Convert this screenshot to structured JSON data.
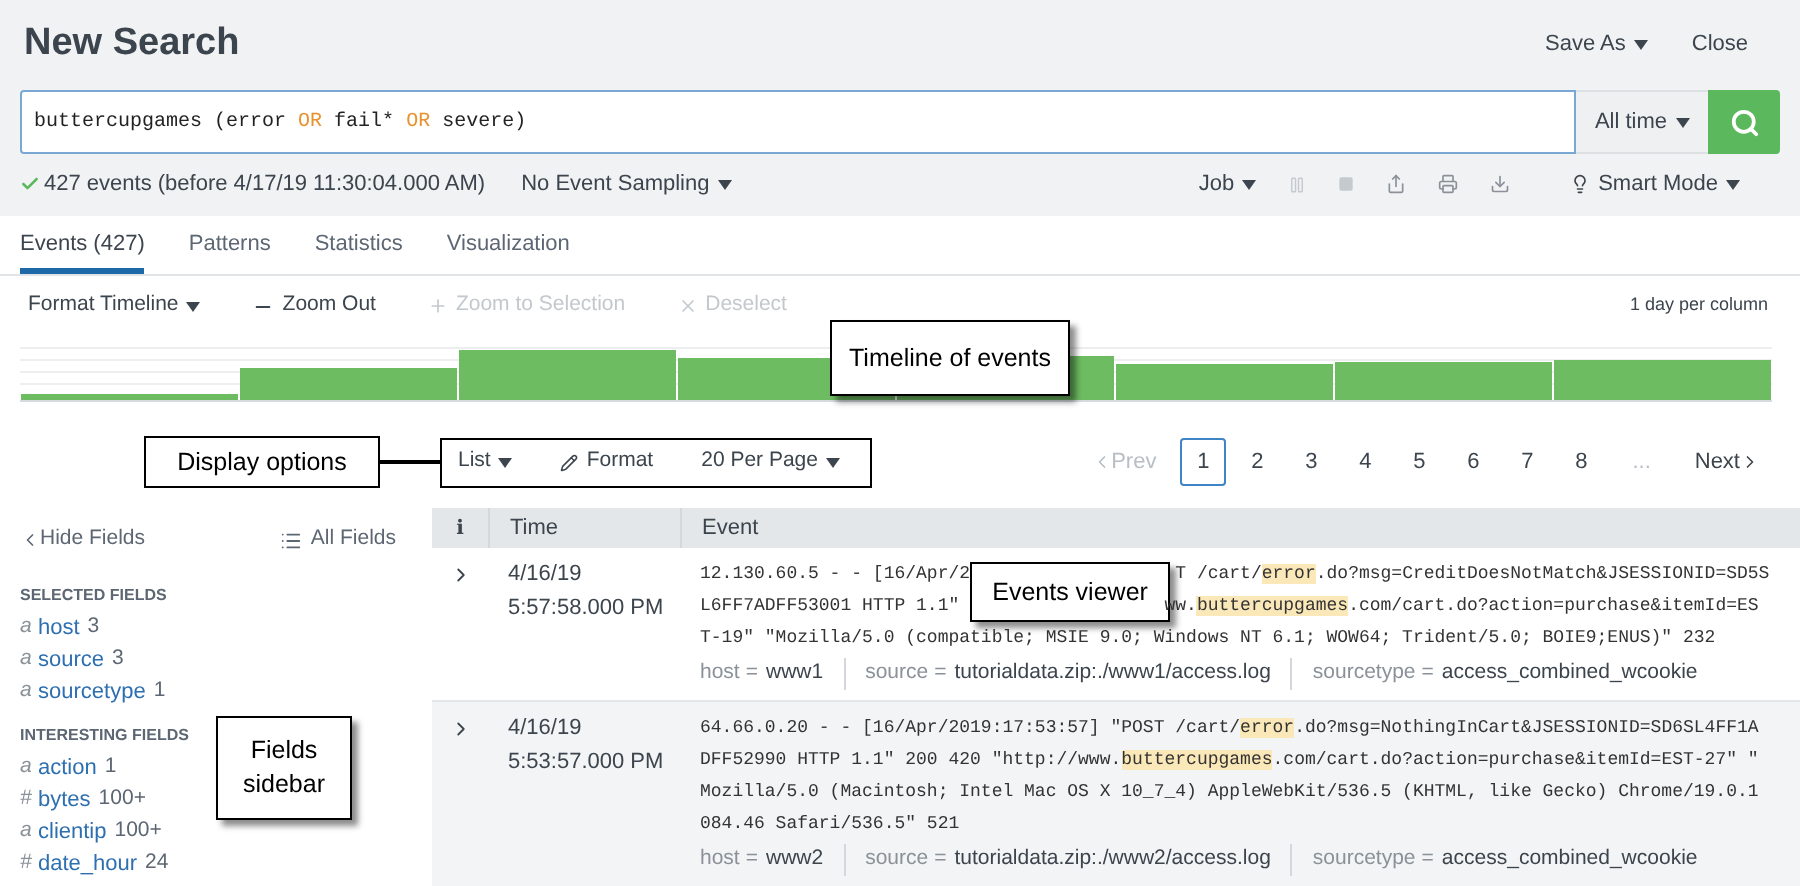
{
  "header": {
    "title": "New Search",
    "actions": [
      "Save As",
      "Close"
    ]
  },
  "search": {
    "query": [
      {
        "text": "buttercupgames (error ",
        "kind": "plain"
      },
      {
        "text": "OR",
        "kind": "keyword"
      },
      {
        "text": " fail* ",
        "kind": "plain"
      },
      {
        "text": "OR",
        "kind": "keyword"
      },
      {
        "text": " severe)",
        "kind": "plain"
      }
    ],
    "time_range": "All time"
  },
  "status": {
    "summary": "427 events (before 4/17/19 11:30:04.000 AM)",
    "sampling": "No Event Sampling",
    "job": "Job",
    "mode": "Smart Mode"
  },
  "tabs": [
    {
      "label": "Events (427)",
      "selected": true
    },
    {
      "label": "Patterns",
      "selected": false
    },
    {
      "label": "Statistics",
      "selected": false
    },
    {
      "label": "Visualization",
      "selected": false
    }
  ],
  "timeline": {
    "controls": [
      {
        "label": "Format Timeline",
        "kind": "menu",
        "disabled": false
      },
      {
        "label": "Zoom Out",
        "kind": "minus",
        "disabled": false
      },
      {
        "label": "Zoom to Selection",
        "kind": "plus",
        "disabled": true
      },
      {
        "label": "Deselect",
        "kind": "cross",
        "disabled": true
      }
    ],
    "scale": "1 day per column",
    "callout": "Timeline of events"
  },
  "display": {
    "callout": "Display options",
    "options": [
      {
        "label": "List",
        "kind": "menu"
      },
      {
        "label": "Format",
        "kind": "edit"
      },
      {
        "label": "20 Per Page",
        "kind": "menu"
      }
    ]
  },
  "pagination": {
    "prev": {
      "label": "Prev",
      "disabled": true
    },
    "pages": [
      {
        "label": "1",
        "selected": true
      },
      {
        "label": "2",
        "selected": false
      },
      {
        "label": "3",
        "selected": false
      },
      {
        "label": "4",
        "selected": false
      },
      {
        "label": "5",
        "selected": false
      },
      {
        "label": "6",
        "selected": false
      },
      {
        "label": "7",
        "selected": false
      },
      {
        "label": "8",
        "selected": false
      }
    ],
    "ellipsis": "...",
    "next": {
      "label": "Next",
      "disabled": false
    }
  },
  "sidebar": {
    "hide": "Hide Fields",
    "all": "All Fields",
    "callout_lines": [
      "Fields",
      "sidebar"
    ],
    "groups": [
      {
        "title": "SELECTED FIELDS",
        "fields": [
          {
            "type": "a",
            "name": "host",
            "count": "3"
          },
          {
            "type": "a",
            "name": "source",
            "count": "3"
          },
          {
            "type": "a",
            "name": "sourcetype",
            "count": "1"
          }
        ]
      },
      {
        "title": "INTERESTING FIELDS",
        "fields": [
          {
            "type": "a",
            "name": "action",
            "count": "1"
          },
          {
            "type": "#",
            "name": "bytes",
            "count": "100+"
          },
          {
            "type": "a",
            "name": "clientip",
            "count": "100+"
          },
          {
            "type": "#",
            "name": "date_hour",
            "count": "24"
          }
        ]
      }
    ]
  },
  "table": {
    "columns": [
      "i",
      "Time",
      "Event"
    ],
    "callout": "Events viewer",
    "rows": [
      {
        "date": "4/16/19",
        "time": "5:57:58.000 PM",
        "lines": [
          [
            {
              "text": "12.130.60.5 - - [16/Apr/2",
              "kind": "plain"
            },
            {
              "kind": "covered"
            },
            {
              "text": "T /cart/",
              "kind": "plain"
            },
            {
              "text": "error",
              "kind": "highlight"
            },
            {
              "text": ".do?msg=CreditDoesNotMatch&JSESSIONID=SD5S",
              "kind": "plain"
            }
          ],
          [
            {
              "text": "L6FF7ADFF53001 HTTP 1.1\"",
              "kind": "plain"
            },
            {
              "kind": "covered"
            },
            {
              "text": "ww.",
              "kind": "plain"
            },
            {
              "text": "buttercupgames",
              "kind": "highlight"
            },
            {
              "text": ".com/cart.do?action=purchase&itemId=ES",
              "kind": "plain"
            }
          ],
          [
            {
              "text": "T-19\" \"Mozilla/5.0 (compatible; MSIE 9.0; Windows NT 6.1; WOW64; Trident/5.0; BOIE9;ENUS)\" 232",
              "kind": "plain"
            }
          ]
        ],
        "fields": [
          {
            "key": "host",
            "op": "=",
            "value": "www1"
          },
          {
            "key": "source",
            "op": "=",
            "value": "tutorialdata.zip:./www1/access.log"
          },
          {
            "key": "sourcetype",
            "op": "=",
            "value": "access_combined_wcookie"
          }
        ]
      },
      {
        "date": "4/16/19",
        "time": "5:53:57.000 PM",
        "lines": [
          [
            {
              "text": "64.66.0.20 - - [16/Apr/2019:17:53:57] \"POST /cart/",
              "kind": "plain"
            },
            {
              "text": "error",
              "kind": "highlight"
            },
            {
              "text": ".do?msg=NothingInCart&JSESSIONID=SD6SL4FF1A",
              "kind": "plain"
            }
          ],
          [
            {
              "text": "DFF52990 HTTP 1.1\" 200 420 \"http://www.",
              "kind": "plain"
            },
            {
              "text": "buttercupgames",
              "kind": "highlight"
            },
            {
              "text": ".com/cart.do?action=purchase&itemId=EST-27\" \"",
              "kind": "plain"
            }
          ],
          [
            {
              "text": "Mozilla/5.0 (Macintosh; Intel Mac OS X 10_7_4) AppleWebKit/536.5 (KHTML, like Gecko) Chrome/19.0.1",
              "kind": "plain"
            }
          ],
          [
            {
              "text": "084.46 Safari/536.5\" 521",
              "kind": "plain"
            }
          ]
        ],
        "fields": [
          {
            "key": "host",
            "op": "=",
            "value": "www2"
          },
          {
            "key": "source",
            "op": "=",
            "value": "tutorialdata.zip:./www2/access.log"
          },
          {
            "key": "sourcetype",
            "op": "=",
            "value": "access_combined_wcookie"
          }
        ]
      }
    ]
  }
}
